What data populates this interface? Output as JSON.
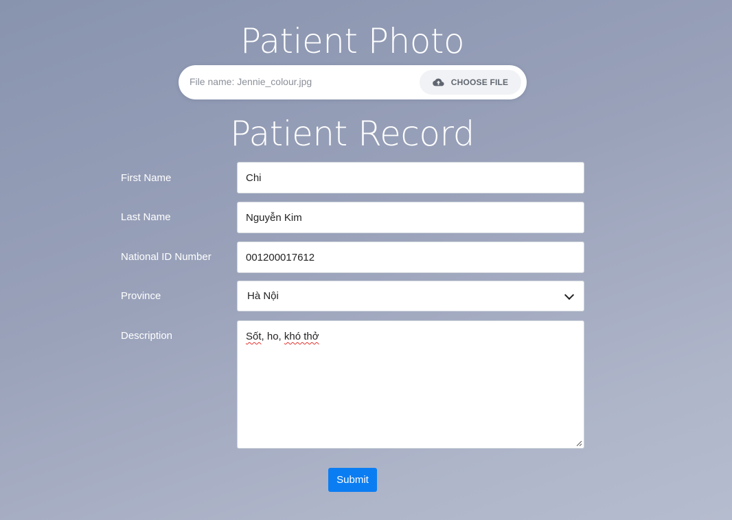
{
  "photo_section": {
    "title": "Patient Photo",
    "file_name": "File name: Jennie_colour.jpg",
    "choose_file_label": "CHOOSE FILE",
    "upload_icon": "cloud-upload-icon"
  },
  "record_section": {
    "title": "Patient Record"
  },
  "form": {
    "first_name": {
      "label": "First Name",
      "value": "Chi"
    },
    "last_name": {
      "label": "Last Name",
      "value": "Nguyễn Kim"
    },
    "national_id": {
      "label": "National ID Number",
      "value": "001200017612"
    },
    "province": {
      "label": "Province",
      "selected": "Hà Nội",
      "icon": "chevron-down-icon"
    },
    "description": {
      "label": "Description",
      "value_parts": [
        "Sốt",
        ", ho, ",
        "khó thở"
      ]
    },
    "submit_label": "Submit"
  },
  "colors": {
    "accent": "#0b7df2",
    "background_top": "#8893ae",
    "background_bottom": "#b6bccf"
  }
}
